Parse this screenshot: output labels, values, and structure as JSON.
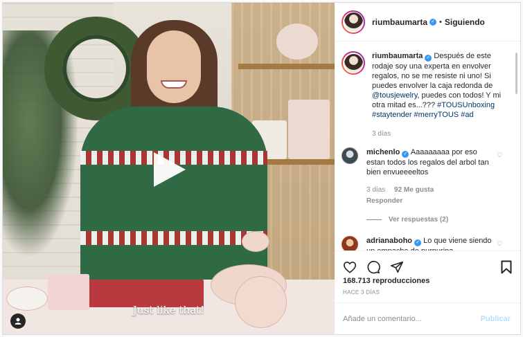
{
  "video": {
    "subtitle": "Just like that!",
    "play_icon": "play-icon",
    "user_tag_icon": "person-icon"
  },
  "header": {
    "username": "riumbaumarta",
    "separator": "•",
    "follow_status": "Siguiendo"
  },
  "caption": {
    "username": "riumbaumarta",
    "text_1": "Después de este rodaje soy una experta en envolver regalos, no se me resiste ni uno! Si puedes envolver la caja redonda de ",
    "mention": "@tousjewelry",
    "text_2": ", puedes con todos! Y mi otra mitad es...???",
    "hashtags": [
      "#TOUSUnboxing",
      "#staytender",
      "#merryTOUS",
      "#ad"
    ],
    "time": "3 días"
  },
  "comments": [
    {
      "username": "michenlo",
      "text": "Aaaaaaaaa por eso estan todos los regalos del arbol tan bien envueeeeltos",
      "time": "3 días",
      "likes": "92 Me gusta",
      "reply_label": "Responder",
      "view_replies": "Ver respuestas (2)"
    },
    {
      "username": "adrianaboho",
      "text": "Lo que viene siendo un empache de purpurina"
    }
  ],
  "stats": {
    "views": "168.713 reproducciones",
    "posted": "HACE 3 DÍAS"
  },
  "add_comment": {
    "placeholder": "Añade un comentario...",
    "post_label": "Publicar"
  },
  "colors": {
    "link": "#003569",
    "verified": "#3897f0",
    "muted": "#8e8e8e",
    "post_disabled": "#b2dffc"
  }
}
